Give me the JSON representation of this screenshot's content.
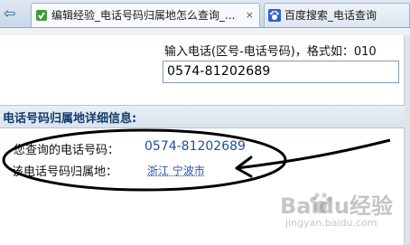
{
  "tabs": [
    {
      "label": "编辑经验_电话号码归属地怎么查询_...",
      "close": "×",
      "active": true
    },
    {
      "label": "百度搜索_电话查询",
      "active": false
    }
  ],
  "form": {
    "hint": "输入电话(区号-电话号码)，格式如：010",
    "phone_value": "0574-81202689"
  },
  "details": {
    "title": "电话号码归属地详细信息:",
    "query_label": "您查询的电话号码：",
    "query_value": "0574-81202689",
    "location_label": "该电话号码归属地：",
    "location_value": "浙江 宁波市"
  },
  "watermark": {
    "brand": "Baidu经验",
    "url": "jingyan.baidu.com"
  },
  "colors": {
    "accent_blue": "#1f4ea0",
    "tab_bar": "#c9d7e8",
    "annotation": "#000000"
  }
}
